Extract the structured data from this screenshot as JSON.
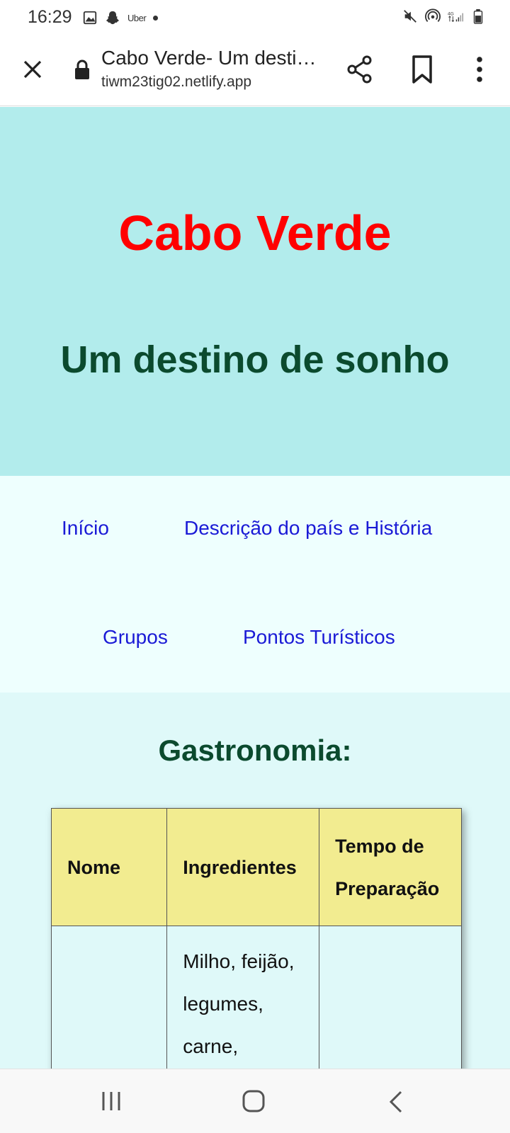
{
  "status_bar": {
    "time": "16:29",
    "uber_label": "Uber",
    "network_label": "4G"
  },
  "browser": {
    "page_title": "Cabo Verde- Um destino de sonho",
    "url": "tiwm23tig02.netlify.app"
  },
  "header": {
    "title": "Cabo Verde",
    "subtitle": "Um destino de sonho",
    "title_color": "#ff0000",
    "subtitle_color": "#0b4a2e",
    "background": "#b2ecec"
  },
  "nav": {
    "links": [
      {
        "label": "Início"
      },
      {
        "label": "Descrição do país e História"
      },
      {
        "label": "Grupos"
      },
      {
        "label": "Pontos Turísticos"
      }
    ],
    "link_color": "#1a1ad6"
  },
  "gastronomia": {
    "heading": "Gastronomia:",
    "table": {
      "headers": [
        "Nome",
        "Ingredientes",
        "Tempo de Preparação"
      ],
      "rows": [
        {
          "nome": "",
          "ingredientes": "Milho, feijão, legumes, carne,",
          "tempo": ""
        }
      ]
    },
    "header_background": "#f2ec90"
  },
  "icons": {
    "status_left": [
      "gallery-icon",
      "snapchat-icon"
    ],
    "status_right": [
      "mute-icon",
      "hotspot-icon",
      "signal-icon",
      "battery-icon"
    ],
    "toolbar": [
      "close-icon",
      "lock-icon",
      "share-icon",
      "bookmark-icon",
      "more-vert-icon"
    ],
    "android_nav": [
      "recent-apps-icon",
      "home-icon",
      "back-icon"
    ]
  }
}
